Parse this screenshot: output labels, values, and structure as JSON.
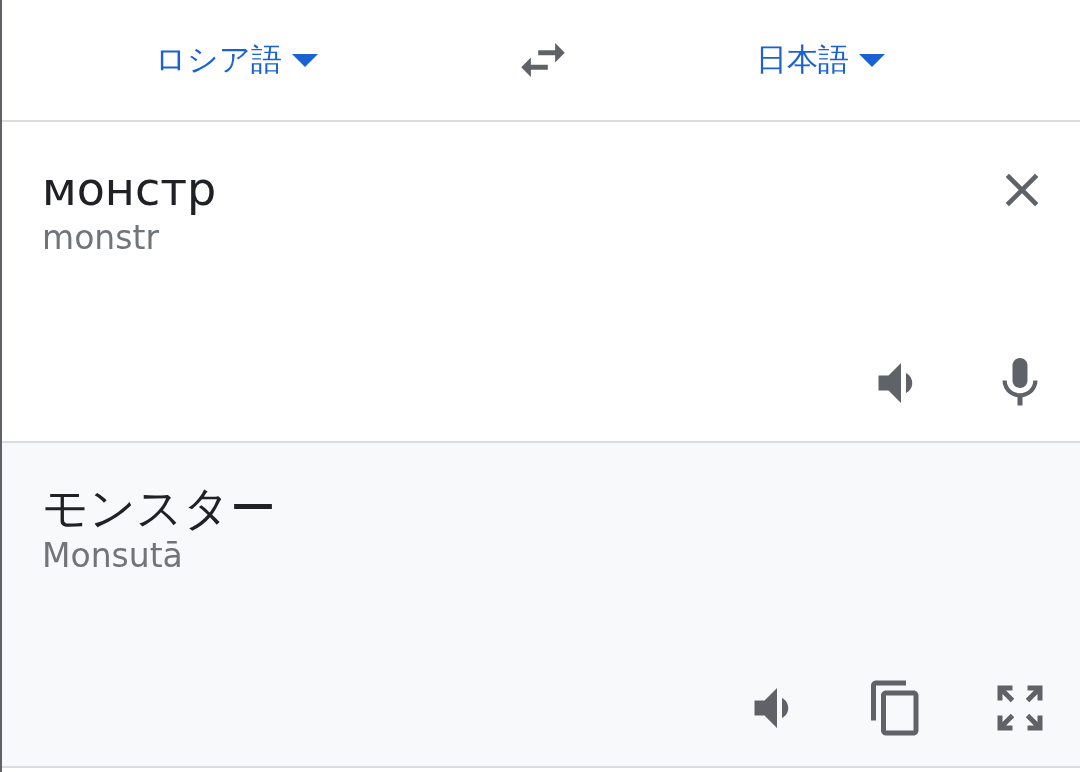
{
  "source_language": {
    "label": "ロシア語"
  },
  "target_language": {
    "label": "日本語"
  },
  "input": {
    "text": "монстр",
    "transliteration": "monstr"
  },
  "output": {
    "text": "モンスター",
    "transliteration": "Monsutā"
  }
}
